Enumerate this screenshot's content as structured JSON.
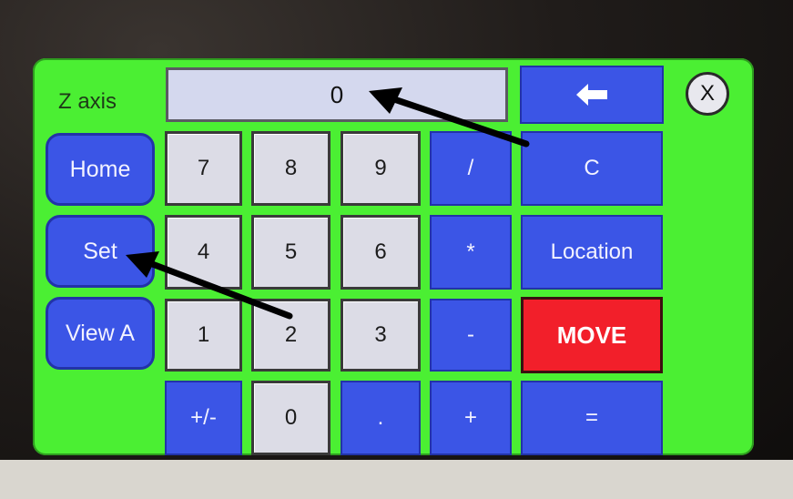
{
  "panel": {
    "axis_label": "Z axis",
    "display_value": "0",
    "close_label": "X",
    "back_label": "🡐"
  },
  "side_buttons": {
    "home": "Home",
    "set": "Set",
    "view": "View A"
  },
  "keypad": {
    "k7": "7",
    "k8": "8",
    "k9": "9",
    "div": "/",
    "clear": "C",
    "k4": "4",
    "k5": "5",
    "k6": "6",
    "mul": "*",
    "location": "Location",
    "k1": "1",
    "k2": "2",
    "k3": "3",
    "minus": "-",
    "move": "MOVE",
    "plusminus": "+/-",
    "k0": "0",
    "dot": ".",
    "plus": "+",
    "equals": "="
  },
  "colors": {
    "screen_bg": "#4bef33",
    "operator_key": "#3b55e6",
    "number_key": "#dcdce6",
    "move_key": "#f21f2a"
  }
}
